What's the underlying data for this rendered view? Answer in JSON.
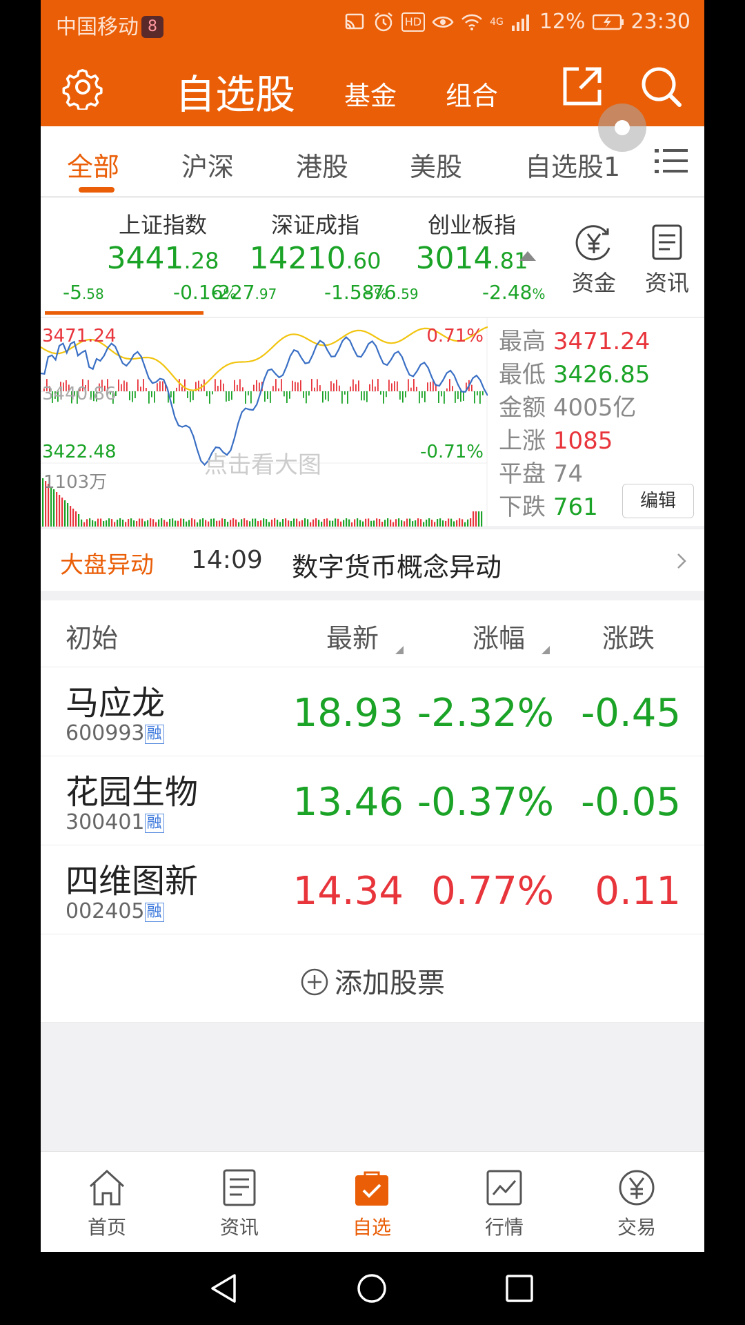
{
  "status_bar": {
    "carrier": "中国移动",
    "carrier_badge": "8",
    "battery_pct": "12%",
    "time": "23:30",
    "hd": "HD",
    "net": "4G"
  },
  "header": {
    "title": "自选股",
    "tabs": [
      "基金",
      "组合"
    ]
  },
  "category_tabs": [
    "全部",
    "沪深",
    "港股",
    "美股",
    "自选股1"
  ],
  "indices": [
    {
      "name": "上证指数",
      "int": "3441",
      "dec": ".28",
      "chg_int": "-5",
      "chg_dec": ".58",
      "pct_int": "-0.16",
      "pct_sym": "%"
    },
    {
      "name": "深证成指",
      "int": "14210",
      "dec": ".60",
      "chg_int": "-227",
      "chg_dec": ".97",
      "pct_int": "-1.58",
      "pct_sym": "%"
    },
    {
      "name": "创业板指",
      "int": "3014",
      "dec": ".81",
      "chg_int": "-76",
      "chg_dec": ".59",
      "pct_int": "-2.48",
      "pct_sym": "%"
    }
  ],
  "index_buttons": {
    "funds": "资金",
    "news": "资讯"
  },
  "chart": {
    "high_label": "3471.24",
    "mid_label": "3440.86",
    "low_label": "3422.48",
    "pct_top": "0.71%",
    "pct_bottom": "-0.71%",
    "volume_label": "1103万",
    "watermark": "点击看大图",
    "colors": {
      "white_line": "#3a6fc4",
      "yellow_line": "#f1c40f",
      "up": "#e8343b",
      "down": "#1aa326"
    }
  },
  "stats": {
    "high_k": "最高",
    "high_v": "3471.24",
    "low_k": "最低",
    "low_v": "3426.85",
    "amount_k": "金额",
    "amount_v": "4005亿",
    "up_k": "上涨",
    "up_v": "1085",
    "flat_k": "平盘",
    "flat_v": "74",
    "down_k": "下跌",
    "down_v": "761",
    "edit": "编辑"
  },
  "alert": {
    "tag": "大盘异动",
    "time": "14:09",
    "message": "数字货币概念异动"
  },
  "list_header": {
    "name": "初始",
    "last": "最新",
    "pct": "涨幅",
    "chg": "涨跌"
  },
  "stocks": [
    {
      "name": "马应龙",
      "code": "600993",
      "badge": "融",
      "last": "18.93",
      "pct": "-2.32%",
      "chg": "-0.45",
      "dir": "down"
    },
    {
      "name": "花园生物",
      "code": "300401",
      "badge": "融",
      "last": "13.46",
      "pct": "-0.37%",
      "chg": "-0.05",
      "dir": "down"
    },
    {
      "name": "四维图新",
      "code": "002405",
      "badge": "融",
      "last": "14.34",
      "pct": "0.77%",
      "chg": "0.11",
      "dir": "up"
    }
  ],
  "add_stock": "添加股票",
  "bottom_nav": [
    "首页",
    "资讯",
    "自选",
    "行情",
    "交易"
  ],
  "accent_color": "#ea5e07"
}
